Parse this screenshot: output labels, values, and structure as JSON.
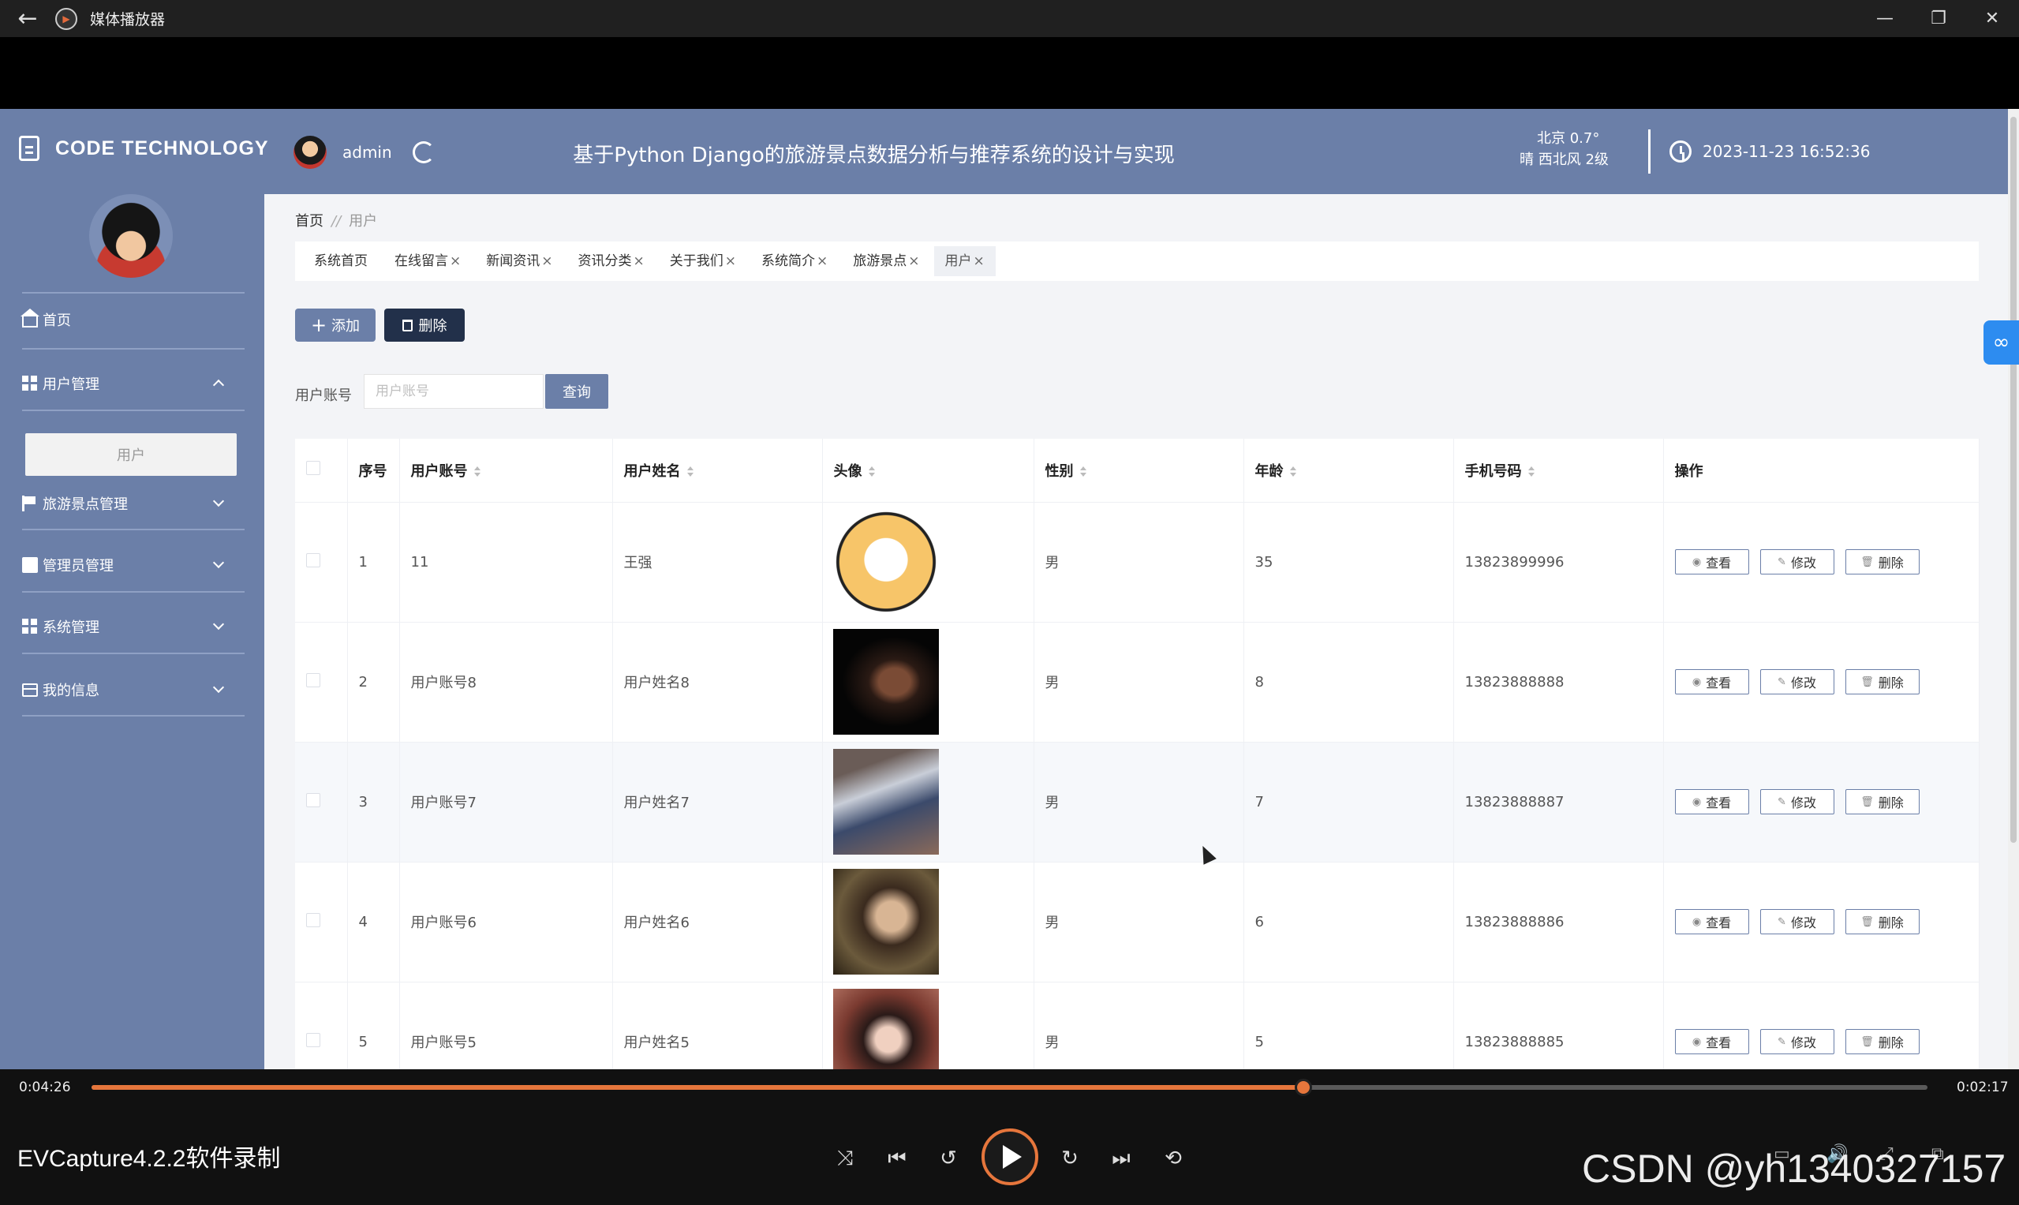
{
  "window": {
    "title": "媒体播放器",
    "back_icon": "←",
    "minimize_icon": "—",
    "restore_icon": "❐",
    "close_icon": "✕"
  },
  "app": {
    "brand": "CODE TECHNOLOGY",
    "user": "admin",
    "site_title": "基于Python Django的旅游景点数据分析与推荐系统的设计与实现",
    "weather_line1": "北京  0.7°",
    "weather_line2": "晴  西北风  2级",
    "datetime": "2023-11-23 16:52:36"
  },
  "sidebar": {
    "home": "首页",
    "user_mgmt": "用户管理",
    "user_sub": "用户",
    "scenic_mgmt": "旅游景点管理",
    "admin_mgmt": "管理员管理",
    "system_mgmt": "系统管理",
    "my_info": "我的信息"
  },
  "breadcrumb": {
    "home": "首页",
    "sep": "//",
    "current": "用户"
  },
  "tabs": [
    {
      "label": "系统首页",
      "close": ""
    },
    {
      "label": "在线留言",
      "close": "×"
    },
    {
      "label": "新闻资讯",
      "close": "×"
    },
    {
      "label": "资讯分类",
      "close": "×"
    },
    {
      "label": "关于我们",
      "close": "×"
    },
    {
      "label": "系统简介",
      "close": "×"
    },
    {
      "label": "旅游景点",
      "close": "×"
    },
    {
      "label": "用户",
      "close": "×"
    }
  ],
  "toolbar": {
    "add": "添加",
    "delete": "删除"
  },
  "search": {
    "label": "用户账号",
    "placeholder": "用户账号",
    "button": "查询"
  },
  "table": {
    "headers": {
      "index": "序号",
      "account": "用户账号",
      "name": "用户姓名",
      "avatar": "头像",
      "gender": "性别",
      "age": "年龄",
      "phone": "手机号码",
      "actions": "操作"
    },
    "actions": {
      "view": "查看",
      "edit": "修改",
      "delete": "删除"
    },
    "rows": [
      {
        "index": "1",
        "account": "11",
        "name": "王强",
        "gender": "男",
        "age": "35",
        "phone": "13823899996"
      },
      {
        "index": "2",
        "account": "用户账号8",
        "name": "用户姓名8",
        "gender": "男",
        "age": "8",
        "phone": "13823888888"
      },
      {
        "index": "3",
        "account": "用户账号7",
        "name": "用户姓名7",
        "gender": "男",
        "age": "7",
        "phone": "13823888887"
      },
      {
        "index": "4",
        "account": "用户账号6",
        "name": "用户姓名6",
        "gender": "男",
        "age": "6",
        "phone": "13823888886"
      },
      {
        "index": "5",
        "account": "用户账号5",
        "name": "用户姓名5",
        "gender": "男",
        "age": "5",
        "phone": "13823888885"
      }
    ]
  },
  "player": {
    "elapsed": "0:04:26",
    "remaining": "0:02:17",
    "progress": 0.66,
    "recorder_label": "EVCapture4.2.2软件录制",
    "watermark": "CSDN @yh1340327157",
    "accent": "#e6763c"
  }
}
